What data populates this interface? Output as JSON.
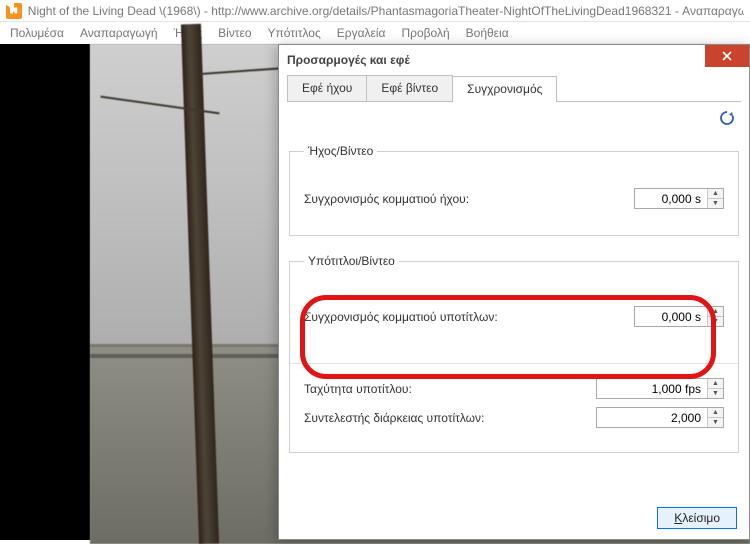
{
  "titlebar": {
    "text": "Night of the Living Dead \\(1968\\) - http://www.archive.org/details/PhantasmagoriaTheater-NightOfTheLivingDead1968321 - Αναπαραγωγ"
  },
  "menu": {
    "media": "Πολυμέσα",
    "playback": "Αναπαραγωγή",
    "audio": "Ήχος",
    "video": "Βίντεο",
    "subtitle": "Υπότιτλος",
    "tools": "Εργαλεία",
    "view": "Προβολή",
    "help": "Βοήθεια"
  },
  "dialog": {
    "title": "Προσαρμογές και εφέ",
    "tabs": {
      "audio": "Εφέ ήχου",
      "video": "Εφέ βίντεο",
      "sync": "Συγχρονισμός"
    },
    "group_av": {
      "legend": "Ήχος/Βίντεο",
      "label": "Συγχρονισμός κομματιού ήχου:",
      "value": "0,000 s"
    },
    "group_sv": {
      "legend": "Υπότιτλοι/Βίντεο",
      "track_label": "Συγχρονισμός κομματιού υποτίτλων:",
      "track_value": "0,000 s",
      "speed_label": "Ταχύτητα υποτίτλου:",
      "speed_value": "1,000 fps",
      "dur_label": "Συντελεστής διάρκειας υποτίτλων:",
      "dur_value": "2,000"
    },
    "close_prefix": "Κ",
    "close_rest": "λείσιμο"
  }
}
